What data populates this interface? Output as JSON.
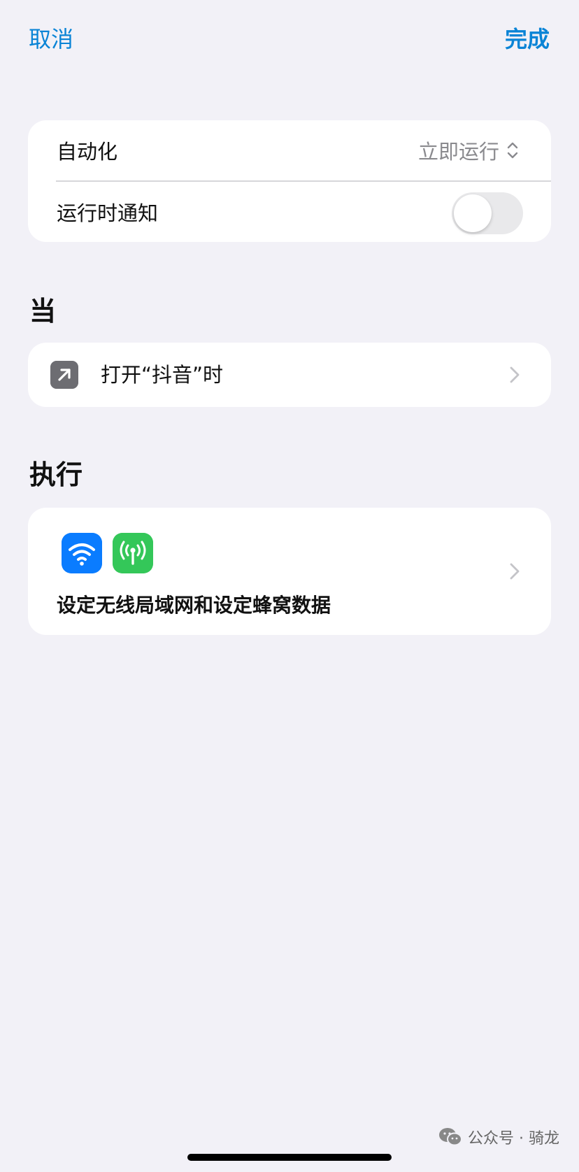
{
  "nav": {
    "cancel_label": "取消",
    "done_label": "完成"
  },
  "settings": {
    "automation_label": "自动化",
    "automation_value": "立即运行",
    "notify_label": "运行时通知",
    "notify_enabled": false
  },
  "when": {
    "section_title": "当",
    "trigger_label": "打开“抖音”时"
  },
  "do": {
    "section_title": "执行",
    "action_label": "设定无线局域网和设定蜂窝数据"
  },
  "watermark": {
    "text": "公众号 · 骑龙"
  },
  "colors": {
    "accent": "#0a84d6",
    "wifi_tile": "#0a7cff",
    "cellular_tile": "#34c759",
    "trigger_tile": "#6d6d72",
    "background": "#f2f1f7"
  }
}
